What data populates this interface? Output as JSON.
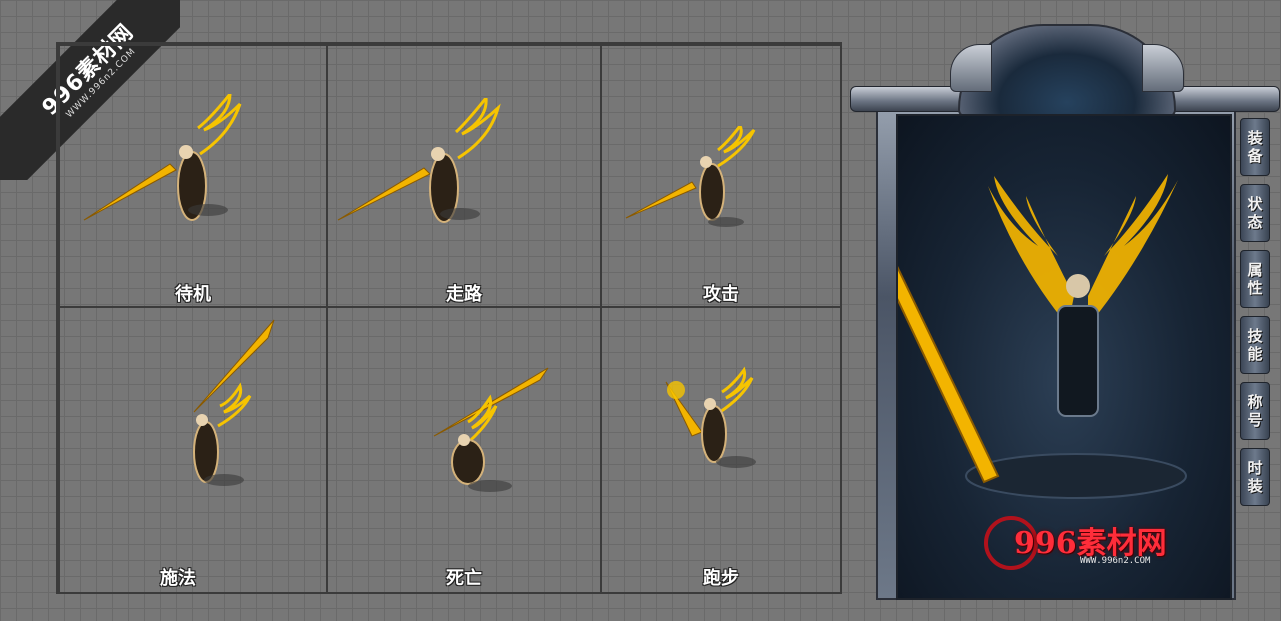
{
  "watermark": {
    "title": "996素材网",
    "url": "WWW.996n2.COM"
  },
  "actions": [
    {
      "label": "待机"
    },
    {
      "label": "走路"
    },
    {
      "label": "攻击"
    },
    {
      "label": "施法"
    },
    {
      "label": "死亡"
    },
    {
      "label": "跑步"
    }
  ],
  "panel": {
    "tabs": [
      {
        "label": "装备"
      },
      {
        "label": "状态"
      },
      {
        "label": "属性"
      },
      {
        "label": "技能"
      },
      {
        "label": "称号"
      },
      {
        "label": "时装"
      }
    ],
    "logo": {
      "text": "996素材网",
      "url": "WWW.996n2.COM"
    }
  },
  "colors": {
    "gold": "#f3b400",
    "background": "#777777",
    "logo_red": "#ff2d3a"
  }
}
